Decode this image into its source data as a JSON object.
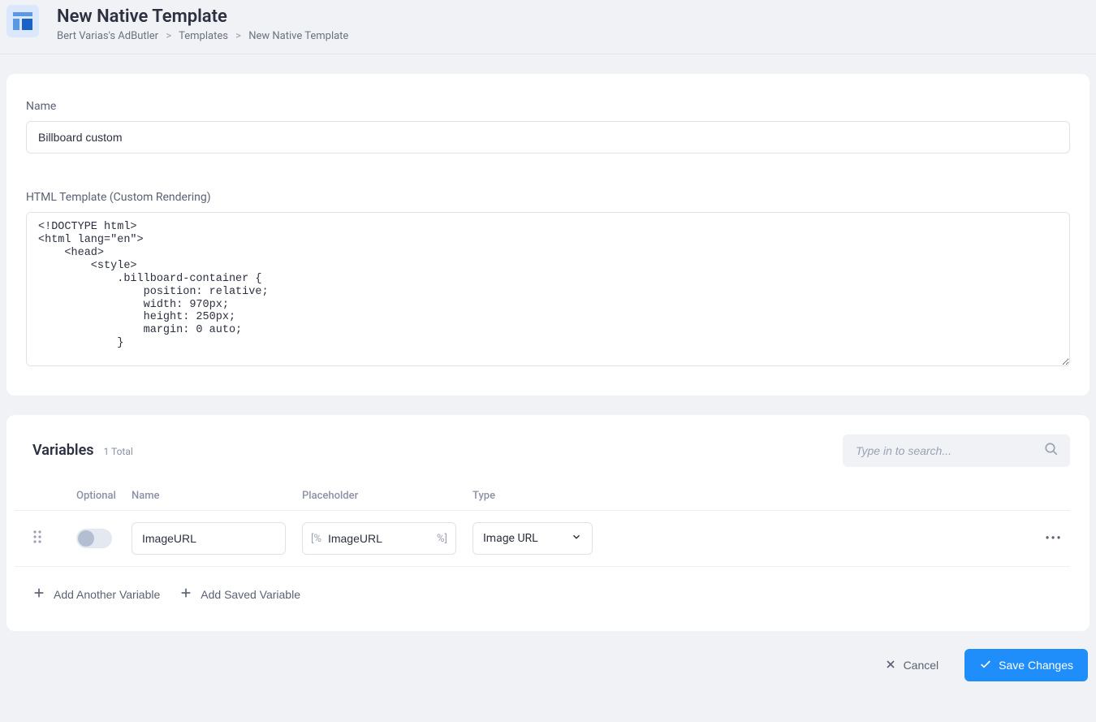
{
  "header": {
    "title": "New Native Template",
    "breadcrumb": {
      "root": "Bert Varias's AdButler",
      "section": "Templates",
      "current": "New Native Template"
    }
  },
  "form": {
    "name_label": "Name",
    "name_value": "Billboard custom",
    "html_label": "HTML Template (Custom Rendering)",
    "html_value": "<!DOCTYPE html>\n<html lang=\"en\">\n    <head>\n        <style>\n            .billboard-container {\n                position: relative;\n                width: 970px;\n                height: 250px;\n                margin: 0 auto;\n            }\n"
  },
  "variables": {
    "title": "Variables",
    "count_label": "1 Total",
    "search_placeholder": "Type in to search...",
    "columns": {
      "optional": "Optional",
      "name": "Name",
      "placeholder": "Placeholder",
      "type": "Type"
    },
    "rows": [
      {
        "optional": false,
        "name": "ImageURL",
        "placeholder_prefix": "[%",
        "placeholder_value": "ImageURL",
        "placeholder_suffix": "%]",
        "type": "Image URL"
      }
    ],
    "add_another_label": "Add Another Variable",
    "add_saved_label": "Add Saved Variable"
  },
  "actions": {
    "cancel": "Cancel",
    "save": "Save Changes"
  }
}
